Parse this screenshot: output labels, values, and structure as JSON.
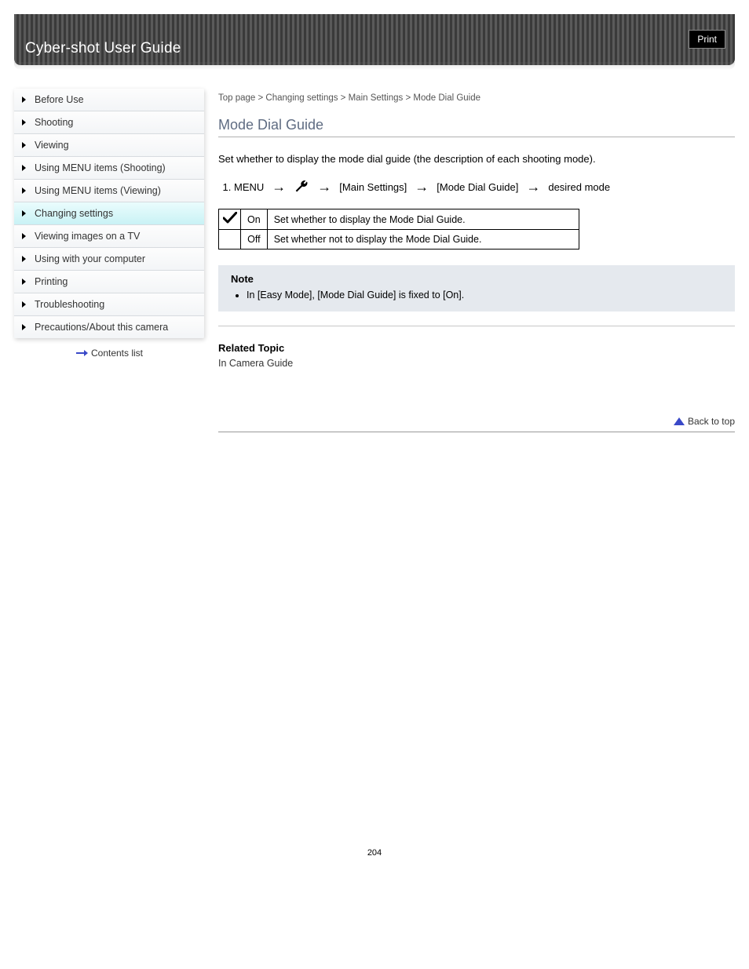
{
  "header": {
    "title": "Cyber-shot User Guide",
    "print_label": "Print"
  },
  "sidebar": {
    "items": [
      {
        "label": "Before Use",
        "active": false
      },
      {
        "label": "Shooting",
        "active": false
      },
      {
        "label": "Viewing",
        "active": false
      },
      {
        "label": "Using MENU items (Shooting)",
        "active": false
      },
      {
        "label": "Using MENU items (Viewing)",
        "active": false
      },
      {
        "label": "Changing settings",
        "active": true
      },
      {
        "label": "Viewing images on a TV",
        "active": false
      },
      {
        "label": "Using with your computer",
        "active": false
      },
      {
        "label": "Printing",
        "active": false
      },
      {
        "label": "Troubleshooting",
        "active": false
      },
      {
        "label": "Precautions/About this camera",
        "active": false
      }
    ],
    "top_link": "Contents list"
  },
  "main": {
    "breadcrumb": "Top page > Changing settings > Main Settings > Mode Dial Guide",
    "title": "Mode Dial Guide",
    "description": "Set whether to display the mode dial guide (the description of each shooting mode).",
    "menu_path": {
      "step1": "MENU",
      "step3a": "[Main Settings]",
      "step3b": "[Mode Dial Guide]",
      "step4": "desired mode"
    },
    "options": [
      {
        "icon": "check",
        "label": "On",
        "text": "Set whether to display the Mode Dial Guide."
      },
      {
        "icon": "",
        "label": "Off",
        "text": "Set whether not to display the Mode Dial Guide."
      }
    ],
    "note": {
      "title": "Note",
      "items": [
        "In [Easy Mode], [Mode Dial Guide] is fixed to [On]."
      ]
    },
    "related_title": "Related Topic",
    "related_link": "In Camera Guide",
    "back_top": "Back to top"
  },
  "page_number": "204"
}
